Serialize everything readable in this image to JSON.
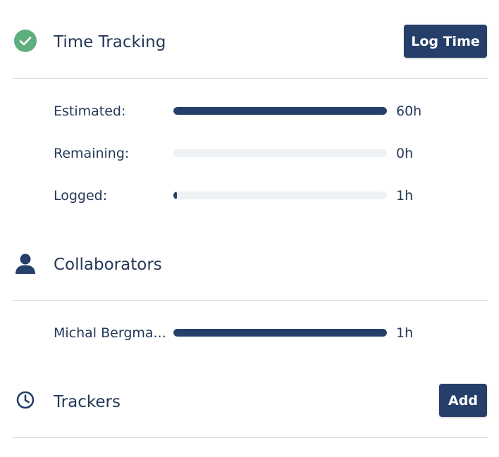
{
  "time_tracking": {
    "title": "Time Tracking",
    "button_label": "Log Time",
    "status_icon": "check-circle-icon",
    "status_color": "#5fae7e",
    "rows": [
      {
        "label": "Estimated:",
        "value": "60h",
        "progress": 1.0
      },
      {
        "label": "Remaining:",
        "value": "0h",
        "progress": 0.0
      },
      {
        "label": "Logged:",
        "value": "1h",
        "progress": 0.017
      }
    ]
  },
  "collaborators": {
    "title": "Collaborators",
    "icon": "user-icon",
    "rows": [
      {
        "label": "Michal Bergma...",
        "value": "1h",
        "progress": 1.0
      }
    ]
  },
  "trackers": {
    "title": "Trackers",
    "icon": "clock-icon",
    "button_label": "Add"
  },
  "colors": {
    "accent": "#253f6a",
    "text": "#253858",
    "track": "#eef2f5",
    "divider": "#d5dee6"
  }
}
